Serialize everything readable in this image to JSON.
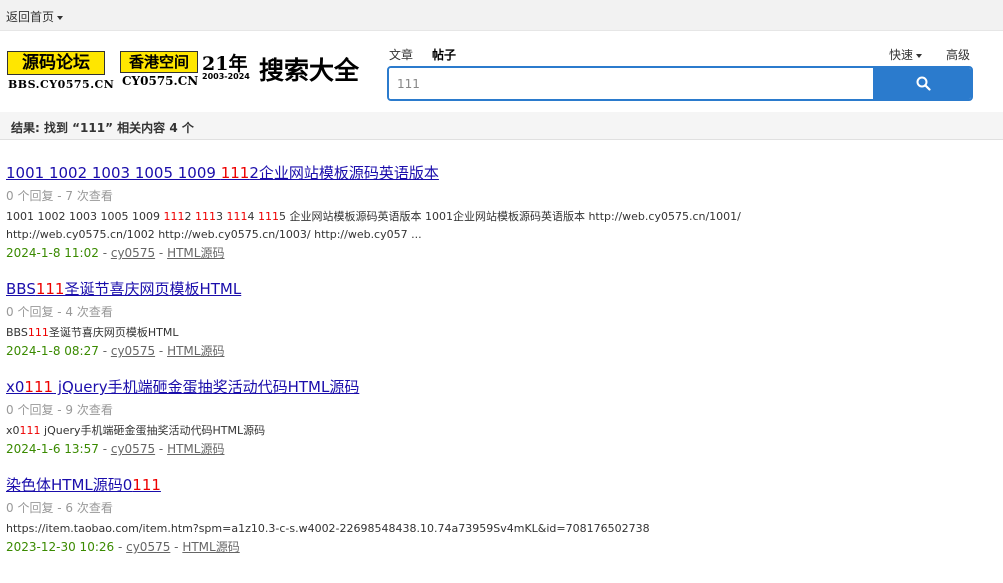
{
  "topbar": {
    "home_label": "返回首页"
  },
  "logo1": {
    "text": "源码论坛",
    "sub": "BBS.CY0575.CN"
  },
  "logo2": {
    "text": "香港空间",
    "sub": "CY0575.CN",
    "years": "21年",
    "range": "2003-2024"
  },
  "site_title": "搜索大全",
  "search": {
    "types": [
      "文章",
      "帖子"
    ],
    "active_type": "帖子",
    "quick_label": "快速",
    "advanced_label": "高级",
    "value": "111",
    "icon": "search-icon",
    "accent": "#2b7bcd"
  },
  "results_summary": "结果: 找到 “111” 相关内容 4 个",
  "results": [
    {
      "title_parts": [
        "1001 1002 1003 1005 1009 ",
        "111",
        "2企业网站模板源码英语版本"
      ],
      "meta": "0 个回复 - 7 次查看",
      "snippet_line1_parts": [
        "1001 1002 1003 1005 1009 ",
        "111",
        "2 ",
        "111",
        "3 ",
        "111",
        "4 ",
        "111",
        "5 企业网站模板源码英语版本 1001企业网站模板源码英语版本 http://web.cy0575.cn/1001/"
      ],
      "snippet_line2": "http://web.cy0575.cn/1002 http://web.cy0575.cn/1003/ http://web.cy057 ...",
      "date": "2024-1-8 11:02",
      "author": "cy0575",
      "forum": "HTML源码"
    },
    {
      "title_parts": [
        "BBS",
        "111",
        "圣诞节喜庆网页模板HTML"
      ],
      "meta": "0 个回复 - 4 次查看",
      "snippet_parts": [
        "BBS",
        "111",
        "圣诞节喜庆网页模板HTML"
      ],
      "date": "2024-1-8 08:27",
      "author": "cy0575",
      "forum": "HTML源码"
    },
    {
      "title_parts": [
        "x0",
        "111",
        " jQuery手机端砸金蛋抽奖活动代码HTML源码"
      ],
      "meta": "0 个回复 - 9 次查看",
      "snippet_parts": [
        "x0",
        "111",
        " jQuery手机端砸金蛋抽奖活动代码HTML源码"
      ],
      "date": "2024-1-6 13:57",
      "author": "cy0575",
      "forum": "HTML源码"
    },
    {
      "title_parts": [
        "染色体HTML源码0",
        "111",
        ""
      ],
      "meta": "0 个回复 - 6 次查看",
      "snippet": "https://item.taobao.com/item.htm?spm=a1z10.3-c-s.w4002-22698548438.10.74a73959Sv4mKL&id=708176502738",
      "date": "2023-12-30 10:26",
      "author": "cy0575",
      "forum": "HTML源码"
    }
  ],
  "separator": " - ",
  "colors": {
    "highlight": "#e00000",
    "title_link": "#1a0dab",
    "date": "#3a8a00"
  }
}
